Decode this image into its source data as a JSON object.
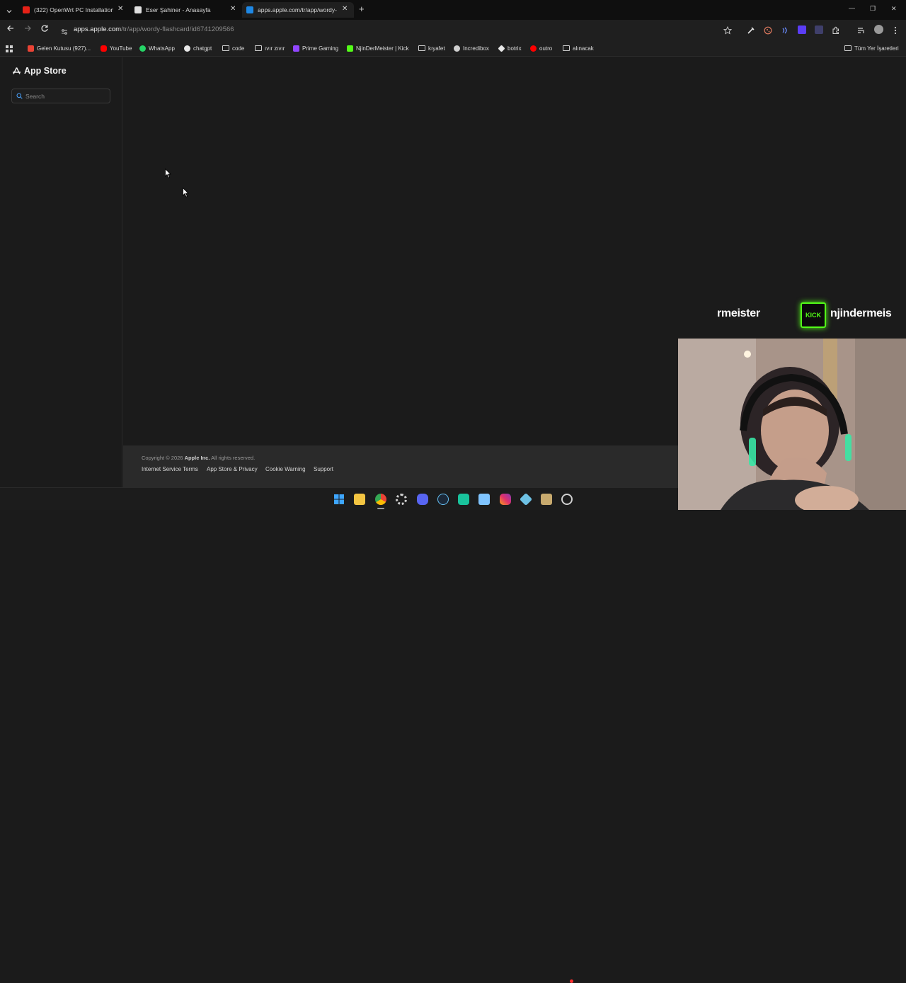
{
  "browser": {
    "tabs": [
      {
        "title": "(322) OpenWrt PC Installation: ",
        "favicon": "youtube-favicon"
      },
      {
        "title": "Eser Şahiner - Anasayfa",
        "favicon": "page-favicon"
      },
      {
        "title": "apps.apple.com/tr/app/wordy-",
        "favicon": "app-store-favicon"
      }
    ],
    "new_tab_label": "+",
    "url": {
      "host": "apps.apple.com",
      "path": "/tr/app/wordy-flashcard/id6741209566"
    },
    "window_controls": {
      "minimize": "—",
      "restore": "❐",
      "close": "✕"
    }
  },
  "bookmarks": {
    "items": [
      {
        "label": "Gelen Kutusu (927)...",
        "icon": "gmail-icon"
      },
      {
        "label": "YouTube",
        "icon": "youtube-icon"
      },
      {
        "label": "WhatsApp",
        "icon": "whatsapp-icon"
      },
      {
        "label": "chatgpt",
        "icon": "chatgpt-icon"
      },
      {
        "label": "code",
        "icon": "folder-icon"
      },
      {
        "label": "ıvır zıvır",
        "icon": "folder-icon"
      },
      {
        "label": "Prime Gaming",
        "icon": "prime-gaming-icon"
      },
      {
        "label": "NjinDerMeister | Kick",
        "icon": "kick-icon"
      },
      {
        "label": "kıyafet",
        "icon": "folder-icon"
      },
      {
        "label": "Incredibox",
        "icon": "incredibox-icon"
      },
      {
        "label": "botrix",
        "icon": "botrix-icon"
      },
      {
        "label": "outro",
        "icon": "youtube-icon"
      },
      {
        "label": "alınacak",
        "icon": "folder-icon"
      }
    ],
    "all_bookmarks": "Tüm Yer İşaretleri"
  },
  "sidebar": {
    "brand": "App Store",
    "search_placeholder": "Search"
  },
  "footer": {
    "copyright_prefix": "Copyright © 2026 ",
    "copyright_company": "Apple Inc.",
    "copyright_suffix": " All rights reserved.",
    "links": [
      "Internet Service Terms",
      "App Store & Privacy",
      "Cookie Warning",
      "Support"
    ]
  },
  "stream_overlay": {
    "banner_left": "rmeister",
    "kick_logo": "KICK",
    "banner_right": "njindermeis"
  },
  "colors": {
    "kick_green": "#53fc18",
    "page_bg": "#1b1b1b",
    "footer_bg": "#2a2a2a"
  }
}
